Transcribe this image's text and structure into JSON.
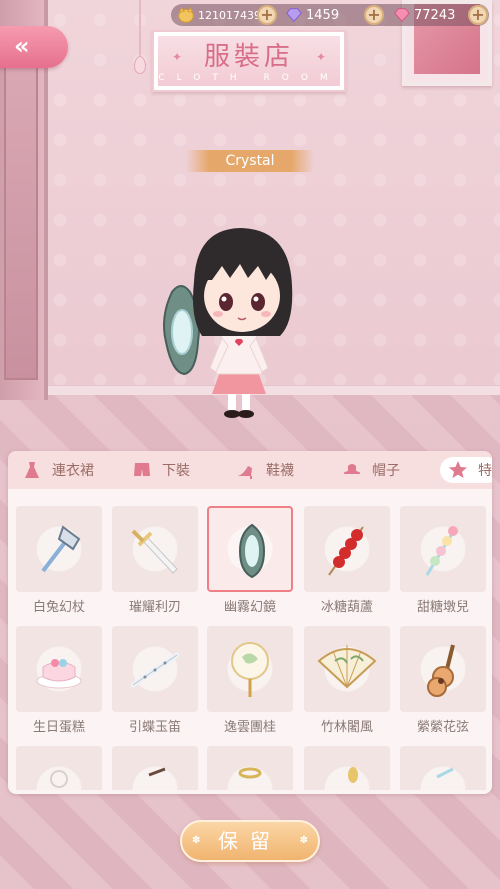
{
  "currency": {
    "coins": "121017439",
    "gems": "1459",
    "diamonds": "77243",
    "add_label": "+"
  },
  "back_button": {
    "label": "«"
  },
  "title": {
    "zh": "服裝店",
    "en": "CLOTH ROOM"
  },
  "character_name": "Crystal",
  "tabs": [
    {
      "label": "連衣裙",
      "icon": "dress-icon"
    },
    {
      "label": "下裝",
      "icon": "shorts-icon"
    },
    {
      "label": "鞋襪",
      "icon": "high-heel-icon"
    },
    {
      "label": "帽子",
      "icon": "hat-icon"
    },
    {
      "label": "特",
      "icon": "star-icon",
      "selected": true
    }
  ],
  "items": [
    {
      "name": "白兔幻杖",
      "icon": "axe-staff-icon"
    },
    {
      "name": "璀耀利刃",
      "icon": "sword-icon"
    },
    {
      "name": "幽霧幻鏡",
      "icon": "mirror-icon",
      "selected": true
    },
    {
      "name": "冰糖葫蘆",
      "icon": "candied-haws-icon"
    },
    {
      "name": "甜糖墩兒",
      "icon": "candy-stick-icon"
    },
    {
      "name": "生日蛋糕",
      "icon": "cake-icon"
    },
    {
      "name": "引蝶玉笛",
      "icon": "flute-icon"
    },
    {
      "name": "逸雲團桂",
      "icon": "round-fan-icon"
    },
    {
      "name": "竹林闍風",
      "icon": "folding-fan-icon"
    },
    {
      "name": "縈縈花弦",
      "icon": "guitar-icon"
    },
    {
      "name": "",
      "icon": "item-icon"
    },
    {
      "name": "",
      "icon": "item-icon"
    },
    {
      "name": "",
      "icon": "item-icon"
    },
    {
      "name": "",
      "icon": "item-icon"
    },
    {
      "name": "",
      "icon": "item-icon"
    }
  ],
  "keep_button": {
    "label": "保留"
  },
  "colors": {
    "accent_pink": "#e6708d",
    "selected_border": "#ef7f84",
    "keep_orange": "#f0b46f"
  }
}
